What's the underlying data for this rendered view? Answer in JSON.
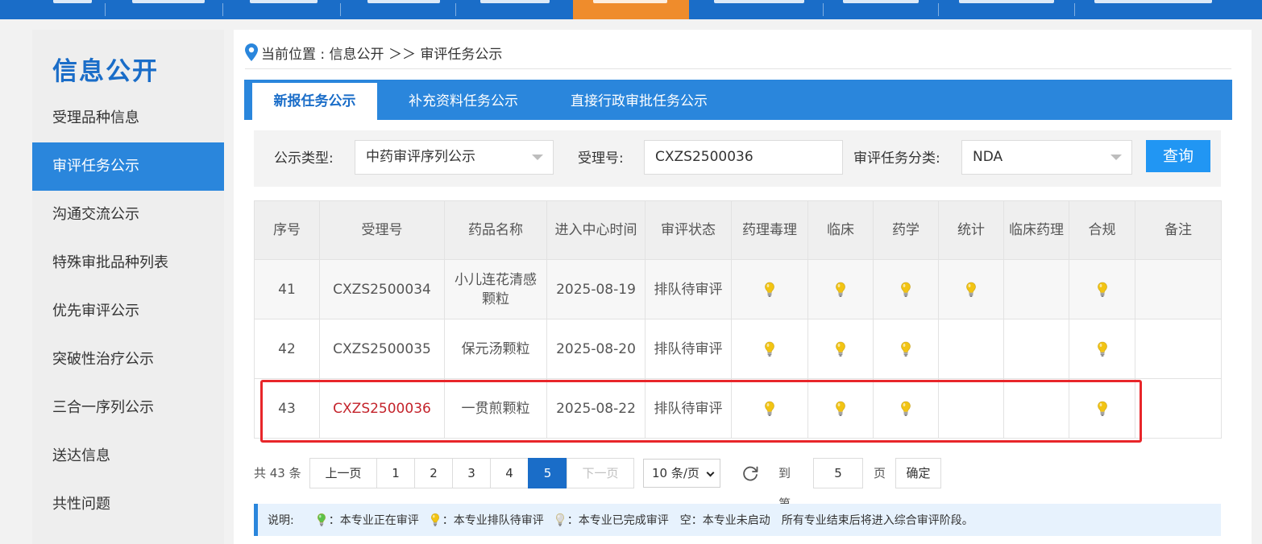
{
  "sidebar": {
    "title": "信息公开",
    "items": [
      {
        "label": "受理品种信息"
      },
      {
        "label": "审评任务公示"
      },
      {
        "label": "沟通交流公示"
      },
      {
        "label": "特殊审批品种列表"
      },
      {
        "label": "优先审评公示"
      },
      {
        "label": "突破性治疗公示"
      },
      {
        "label": "三合一序列公示"
      },
      {
        "label": "送达信息"
      },
      {
        "label": "共性问题"
      }
    ]
  },
  "breadcrumb": {
    "text": "当前位置 : 信息公开 ＞＞ 审评任务公示"
  },
  "tabs": [
    {
      "label": "新报任务公示"
    },
    {
      "label": "补充资料任务公示"
    },
    {
      "label": "直接行政审批任务公示"
    }
  ],
  "filter": {
    "type_label": "公示类型:",
    "type_value": "中药审评序列公示",
    "acceptance_label": "受理号:",
    "acceptance_value": "CXZS2500036",
    "category_label": "审评任务分类:",
    "category_value": "NDA",
    "query_label": "查询"
  },
  "table": {
    "headers": [
      "序号",
      "受理号",
      "药品名称",
      "进入中心时间",
      "审评状态",
      "药理毒理",
      "临床",
      "药学",
      "统计",
      "临床药理",
      "合规",
      "备注"
    ],
    "rows": [
      {
        "no": "41",
        "acceptance": "CXZS2500034",
        "drug": "小儿连花清感颗粒",
        "date": "2025-08-19",
        "status": "排队待审评",
        "marks": [
          "queued",
          "queued",
          "queued",
          "queued",
          "",
          "queued"
        ]
      },
      {
        "no": "42",
        "acceptance": "CXZS2500035",
        "drug": "保元汤颗粒",
        "date": "2025-08-20",
        "status": "排队待审评",
        "marks": [
          "queued",
          "queued",
          "queued",
          "",
          "",
          "queued"
        ]
      },
      {
        "no": "43",
        "acceptance": "CXZS2500036",
        "drug": "一贯煎颗粒",
        "date": "2025-08-22",
        "status": "排队待审评",
        "marks": [
          "queued",
          "queued",
          "queued",
          "",
          "",
          "queued"
        ]
      }
    ]
  },
  "pager": {
    "total": "共 43 条",
    "prev": "上一页",
    "pages": [
      "1",
      "2",
      "3",
      "4",
      "5"
    ],
    "current": "5",
    "next": "下一页",
    "page_size": "10 条/页",
    "goto_label": "到第",
    "goto_value": "5",
    "page_unit": "页",
    "confirm": "确定"
  },
  "legend": {
    "title": "说明:",
    "in_review": "：本专业正在审评",
    "queued": "：本专业排队待审评",
    "done": "：本专业已完成审评",
    "empty": "空：本专业未启动",
    "note": "所有专业结束后将进入综合审评阶段。"
  },
  "colors": {
    "accent": "#2a86dc",
    "nav_active": "#ef8c2c",
    "highlight_text": "#c4232b",
    "highlight_box": "#e8262a",
    "bulb_queued": "#f2c413",
    "bulb_in_review": "#5cc24a",
    "bulb_done": "#d8d8d8"
  }
}
